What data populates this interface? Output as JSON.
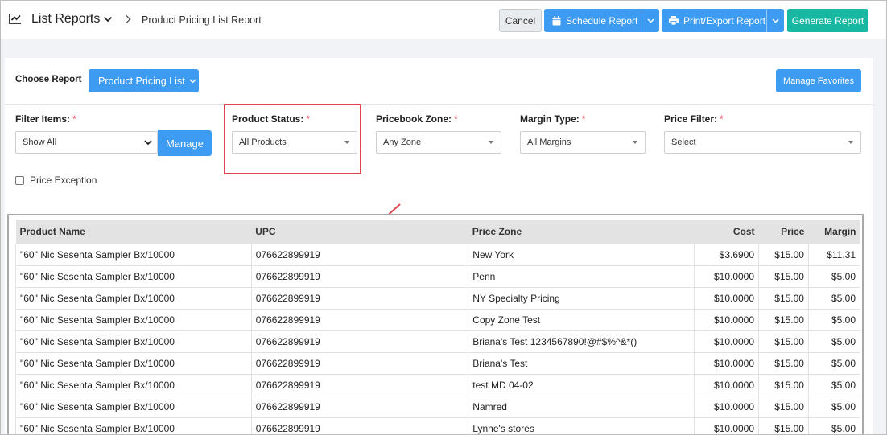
{
  "header": {
    "title": "List Reports",
    "breadcrumb": "Product Pricing List Report",
    "cancel_label": "Cancel",
    "schedule_label": "Schedule Report",
    "print_label": "Print/Export Report",
    "generate_label": "Generate Report"
  },
  "report": {
    "choose_label": "Choose Report",
    "selected": "Product Pricing List",
    "manage_favorites_label": "Manage Favorites"
  },
  "filters": {
    "required_mark": "*",
    "filter_items": {
      "label": "Filter Items:",
      "value": "Show All",
      "manage_label": "Manage"
    },
    "product_status": {
      "label": "Product Status:",
      "value": "All Products"
    },
    "pricebook_zone": {
      "label": "Pricebook Zone:",
      "value": "Any Zone"
    },
    "margin_type": {
      "label": "Margin Type:",
      "value": "All Margins"
    },
    "price_filter": {
      "label": "Price Filter:",
      "value": "Select"
    },
    "price_exception_label": "Price Exception"
  },
  "table": {
    "columns": [
      "Product Name",
      "UPC",
      "Price Zone",
      "Cost",
      "Price",
      "Margin"
    ],
    "rows": [
      [
        "\"60\" Nic Sesenta Sampler Bx/10000",
        "076622899919",
        "New York",
        "$3.6900",
        "$15.00",
        "$11.31"
      ],
      [
        "\"60\" Nic Sesenta Sampler Bx/10000",
        "076622899919",
        "Penn",
        "$10.0000",
        "$15.00",
        "$5.00"
      ],
      [
        "\"60\" Nic Sesenta Sampler Bx/10000",
        "076622899919",
        "NY Specialty Pricing",
        "$10.0000",
        "$15.00",
        "$5.00"
      ],
      [
        "\"60\" Nic Sesenta Sampler Bx/10000",
        "076622899919",
        "Copy Zone Test",
        "$10.0000",
        "$15.00",
        "$5.00"
      ],
      [
        "\"60\" Nic Sesenta Sampler Bx/10000",
        "076622899919",
        "Briana's Test 1234567890!@#$%^&*()",
        "$10.0000",
        "$15.00",
        "$5.00"
      ],
      [
        "\"60\" Nic Sesenta Sampler Bx/10000",
        "076622899919",
        "Briana's Test",
        "$10.0000",
        "$15.00",
        "$5.00"
      ],
      [
        "\"60\" Nic Sesenta Sampler Bx/10000",
        "076622899919",
        "test MD 04-02",
        "$10.0000",
        "$15.00",
        "$5.00"
      ],
      [
        "\"60\" Nic Sesenta Sampler Bx/10000",
        "076622899919",
        "Namred",
        "$10.0000",
        "$15.00",
        "$5.00"
      ],
      [
        "\"60\" Nic Sesenta Sampler Bx/10000",
        "076622899919",
        "Lynne's stores",
        "$10.0000",
        "$15.00",
        "$5.00"
      ]
    ]
  },
  "icons": {
    "header": "line-chart-icon",
    "schedule": "calendar-icon",
    "print": "printer-icon",
    "annotation": "red-arrow-icon"
  },
  "colors": {
    "primary": "#3d9bf1",
    "generate": "#17b7a1",
    "highlight": "#e0434e",
    "required": "#e0394b"
  }
}
